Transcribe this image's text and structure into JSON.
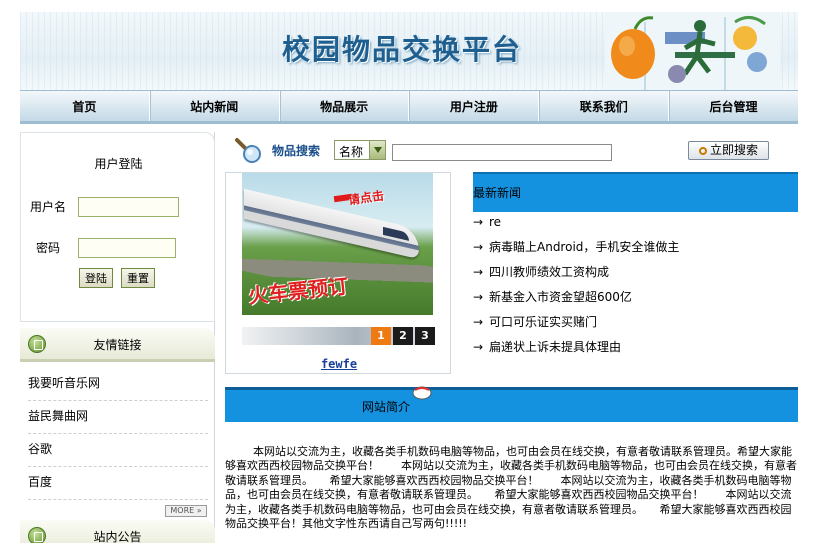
{
  "header": {
    "site_title": "校园物品交换平台"
  },
  "nav": {
    "items": [
      "首页",
      "站内新闻",
      "物品展示",
      "用户注册",
      "联系我们",
      "后台管理"
    ]
  },
  "login": {
    "title": "用户登陆",
    "username_label": "用户名",
    "password_label": "密码",
    "username_value": "",
    "password_value": "",
    "login_button": "登陆",
    "reset_button": "重置"
  },
  "links_section": {
    "title": "友情链接",
    "items": [
      "我要听音乐网",
      "益民舞曲网",
      "谷歌",
      "百度"
    ],
    "more_label": "MORE »"
  },
  "notice_section": {
    "title": "站内公告"
  },
  "search": {
    "label": "物品搜索",
    "select_value": "名称",
    "input_value": "",
    "button_label": "立即搜索"
  },
  "showcase": {
    "ad_top": "请点击",
    "ad_bottom": "火车票预订",
    "pages": [
      "1",
      "2",
      "3"
    ],
    "active_page": "1",
    "caption": "fewfe"
  },
  "news": {
    "title": "最新新闻",
    "arrow": "→",
    "items": [
      "re",
      "病毒瞄上Android，手机安全谁做主",
      "四川教师绩效工资构成",
      "新基金入市资金望超600亿",
      "可口可乐证实买赌门",
      "扁递状上诉未提具体理由"
    ]
  },
  "intro": {
    "title": "网站简介",
    "text": "本网站以交流为主，收藏各类手机数码电脑等物品，也可由会员在线交换，有意者敬请联系管理员。希望大家能够喜欢西西校园物品交换平台！　　本网站以交流为主，收藏各类手机数码电脑等物品，也可由会员在线交换，有意者敬请联系管理员。　　希望大家能够喜欢西西校园物品交换平台！　　本网站以交流为主，收藏各类手机数码电脑等物品，也可由会员在线交换，有意者敬请联系管理员。　　希望大家能够喜欢西西校园物品交换平台！　　本网站以交流为主，收藏各类手机数码电脑等物品，也可由会员在线交换，有意者敬请联系管理员。　　希望大家能够喜欢西西校园物品交换平台！其他文字性东西请自己写两句!!!!!"
  }
}
